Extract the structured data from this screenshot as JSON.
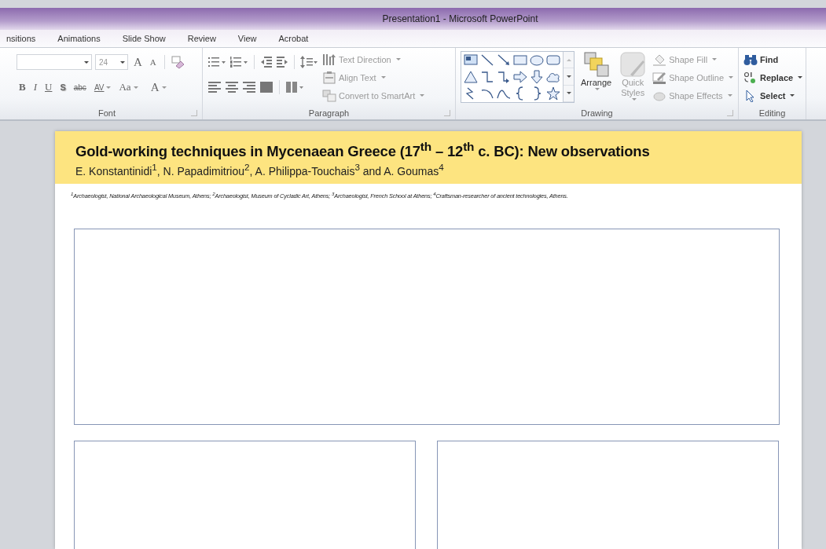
{
  "window": {
    "title": "Presentation1  -  Microsoft PowerPoint"
  },
  "tabs": [
    {
      "label": "nsitions"
    },
    {
      "label": "Animations"
    },
    {
      "label": "Slide Show"
    },
    {
      "label": "Review"
    },
    {
      "label": "View"
    },
    {
      "label": "Acrobat"
    }
  ],
  "ribbon": {
    "font": {
      "label": "Font",
      "size": "24",
      "sizers": [
        {
          "label": "A",
          "kind": "grow"
        },
        {
          "label": "A",
          "kind": "shrink"
        }
      ],
      "buttons": [
        {
          "label": "B",
          "kind": "bold"
        },
        {
          "label": "I",
          "kind": "italic"
        },
        {
          "label": "U",
          "kind": "underline"
        },
        {
          "label": "S",
          "kind": "shadow"
        },
        {
          "label": "abc",
          "kind": "strike"
        },
        {
          "label": "AV",
          "kind": "spacing"
        },
        {
          "label": "Aa",
          "kind": "case"
        },
        {
          "label": "A",
          "kind": "color"
        }
      ]
    },
    "paragraph": {
      "label": "Paragraph",
      "commands": [
        {
          "label": "Text Direction",
          "kind": "direction",
          "disabled": true
        },
        {
          "label": "Align Text",
          "kind": "align",
          "disabled": true
        },
        {
          "label": "Convert to SmartArt",
          "kind": "smartart",
          "disabled": true
        }
      ]
    },
    "drawing": {
      "label": "Drawing",
      "big_buttons": [
        {
          "label": "Arrange",
          "kind": "arrange",
          "disabled": false
        },
        {
          "label": "Quick Styles",
          "kind": "styles",
          "disabled": true
        }
      ],
      "commands": [
        {
          "label": "Shape Fill",
          "kind": "fill",
          "disabled": true
        },
        {
          "label": "Shape Outline",
          "kind": "outline",
          "disabled": true
        },
        {
          "label": "Shape Effects",
          "kind": "effects",
          "disabled": true
        }
      ]
    },
    "editing": {
      "label": "Editing",
      "commands": [
        {
          "label": "Find",
          "kind": "find",
          "disabled": false
        },
        {
          "label": "Replace",
          "kind": "replace",
          "disabled": false
        },
        {
          "label": "Select",
          "kind": "select",
          "disabled": false
        }
      ]
    }
  },
  "slide": {
    "title": "Gold-working techniques in Mycenaean Greece (17$^{th}$ – 12$^{th}$ c. BC): New observations",
    "authors": "E. Konstantinidi$^{1}$, N. Papadimitriou$^{2}$, A. Philippa-Touchais$^{3}$ and A. Goumas$^{4}$",
    "affiliations": "$^{1}$Archaeologist, National Archaeological Museum, Athens; $^{2}$Archaeologist, Museum of Cycladic Art, Athens; $^{3}$Archaeologist, French School at Athens; $^{4}$Craftsman-researcher of ancient technologies, Athens.",
    "panels": [
      {
        "kind": "wide"
      },
      {
        "kind": "half"
      },
      {
        "kind": "half"
      }
    ]
  }
}
